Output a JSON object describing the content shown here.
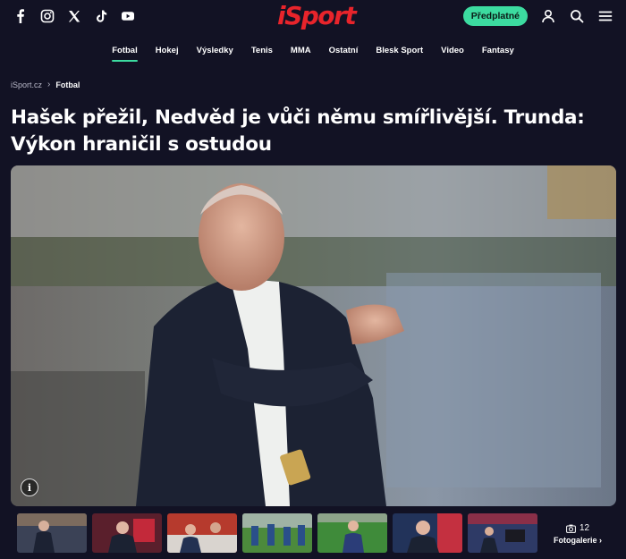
{
  "header": {
    "logo_text": "iSport",
    "subscribe_label": "Předplatné",
    "social": [
      "facebook-icon",
      "instagram-icon",
      "x-icon",
      "tiktok-icon",
      "youtube-icon"
    ],
    "tools": [
      "user-icon",
      "search-icon",
      "menu-icon"
    ]
  },
  "nav": {
    "items": [
      {
        "label": "Fotbal",
        "active": true
      },
      {
        "label": "Hokej"
      },
      {
        "label": "Výsledky"
      },
      {
        "label": "Tenis"
      },
      {
        "label": "MMA"
      },
      {
        "label": "Ostatní"
      },
      {
        "label": "Blesk Sport"
      },
      {
        "label": "Video"
      },
      {
        "label": "Fantasy"
      }
    ]
  },
  "breadcrumb": {
    "home": "iSport.cz",
    "current": "Fotbal"
  },
  "article": {
    "title": "Hašek přežil, Nedvěd je vůči němu smířlivější. Trunda: Výkon hraničil s ostudou"
  },
  "gallery": {
    "count": "12",
    "label": "Fotogalerie",
    "thumb_count": 7
  },
  "colors": {
    "background": "#121224",
    "accent": "#3cdba0",
    "brand": "#e8242b"
  }
}
